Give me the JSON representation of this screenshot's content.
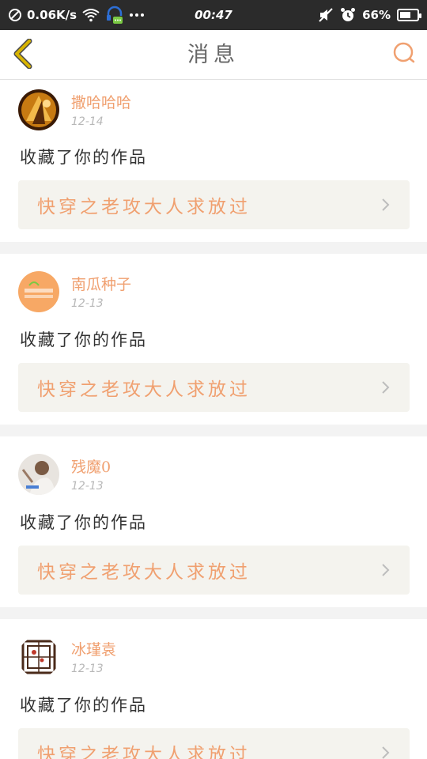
{
  "status_bar": {
    "net_speed": "0.06K/s",
    "time": "00:47",
    "battery": "66%",
    "battery_level": 0.66,
    "icons": [
      "blocked-icon",
      "wifi-icon",
      "headset-icon",
      "more-dots-icon",
      "mute-icon",
      "alarm-icon",
      "battery-icon"
    ]
  },
  "header": {
    "title": "消息",
    "back_icon": "chevron-left-icon",
    "search_icon": "search-icon"
  },
  "colors": {
    "accent": "#f0a070",
    "back_icon": "#d8b400",
    "card_link_bg": "#f4f3ee"
  },
  "messages": [
    {
      "username": "撒哈哈哈",
      "date": "12-14",
      "action": "收藏了你的作品",
      "work_title": "快穿之老攻大人求放过",
      "avatar": "avatar-photo-1"
    },
    {
      "username": "南瓜种子",
      "date": "12-13",
      "action": "收藏了你的作品",
      "work_title": "快穿之老攻大人求放过",
      "avatar": "avatar-photo-2"
    },
    {
      "username": "残魔0",
      "date": "12-13",
      "action": "收藏了你的作品",
      "work_title": "快穿之老攻大人求放过",
      "avatar": "avatar-photo-3"
    },
    {
      "username": "冰瑾袁",
      "date": "12-13",
      "action": "收藏了你的作品",
      "work_title": "快穿之老攻大人求放过",
      "avatar": "avatar-photo-4"
    }
  ]
}
